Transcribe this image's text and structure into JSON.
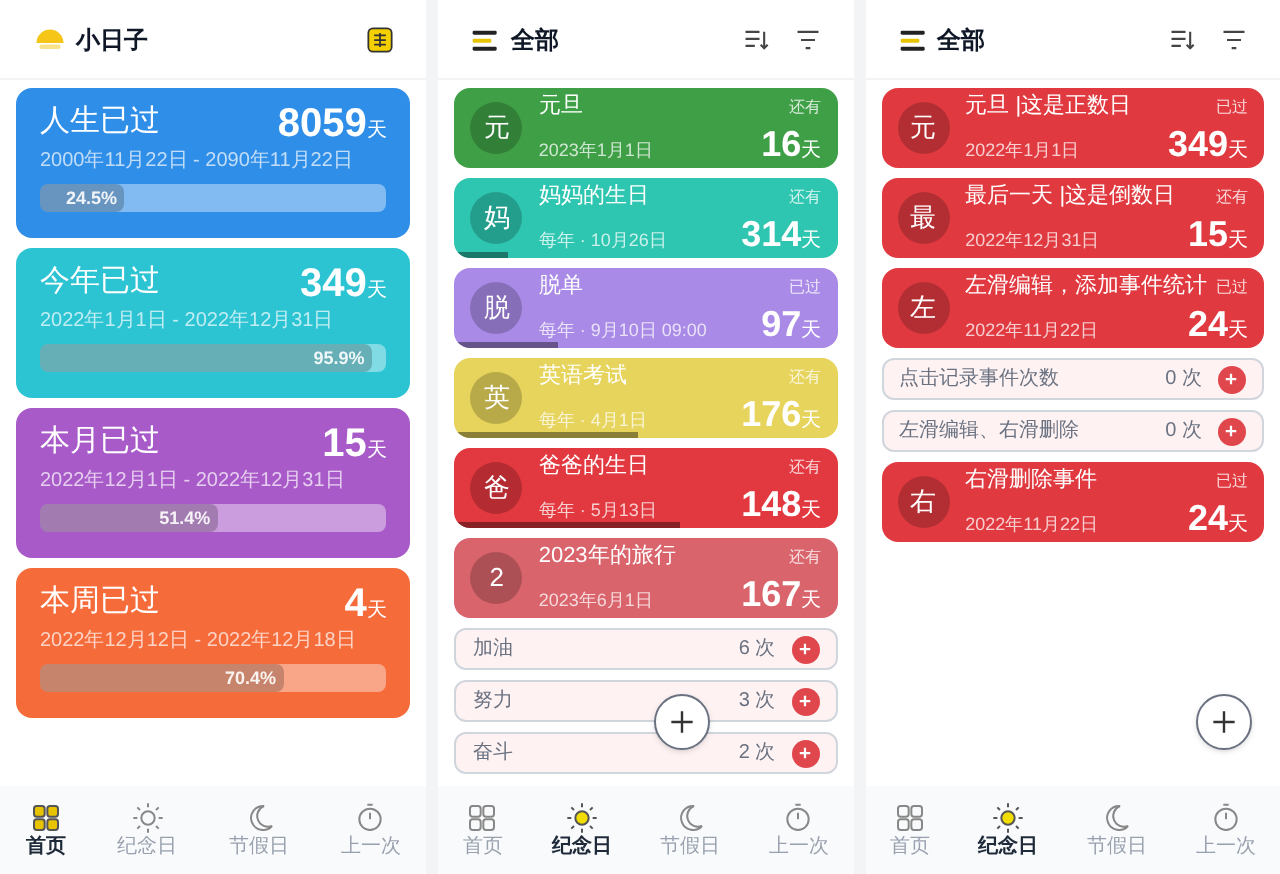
{
  "screens": [
    {
      "kind": "overview",
      "header": {
        "title": "小日子"
      },
      "cards": [
        {
          "title": "人生已过",
          "dates": "2000年11月22日 - 2090年11月22日",
          "count": "8059",
          "unit": "天",
          "percent": "24.5%",
          "level": 0.245,
          "color": "#2f8ee8"
        },
        {
          "title": "今年已过",
          "dates": "2022年1月1日 - 2022年12月31日",
          "count": "349",
          "unit": "天",
          "percent": "95.9%",
          "level": 0.959,
          "color": "#2cc3d3"
        },
        {
          "title": "本月已过",
          "dates": "2022年12月1日 - 2022年12月31日",
          "count": "15",
          "unit": "天",
          "percent": "51.4%",
          "level": 0.514,
          "color": "#a85bc8"
        },
        {
          "title": "本周已过",
          "dates": "2022年12月12日 - 2022年12月18日",
          "count": "4",
          "unit": "天",
          "percent": "70.4%",
          "level": 0.704,
          "color": "#f56b3a"
        }
      ],
      "nav": [
        {
          "label": "首页",
          "selected": true
        },
        {
          "label": "纪念日",
          "selected": false
        },
        {
          "label": "节假日",
          "selected": false
        },
        {
          "label": "上一次",
          "selected": false
        }
      ]
    },
    {
      "kind": "list",
      "header": {
        "title": "全部"
      },
      "items": [
        {
          "kind": "event",
          "avatar": "元",
          "title": "元旦",
          "subtitle": "2023年1月1日",
          "tag": "还有",
          "count": "16",
          "unit": "天",
          "color": "#3f9f47"
        },
        {
          "kind": "event",
          "avatar": "妈",
          "title": "妈妈的生日",
          "subtitle": "每年 · 10月26日",
          "tag": "还有",
          "count": "314",
          "unit": "天",
          "color": "#2ec6b0",
          "level": 0.14
        },
        {
          "kind": "event",
          "avatar": "脱",
          "title": "脱单",
          "subtitle": "每年 · 9月10日 09:00",
          "tag": "已过",
          "count": "97",
          "unit": "天",
          "color": "#a98ae6",
          "level": 0.27
        },
        {
          "kind": "event",
          "avatar": "英",
          "title": "英语考试",
          "subtitle": "每年 · 4月1日",
          "tag": "还有",
          "count": "176",
          "unit": "天",
          "color": "#e7d45c",
          "level": 0.48
        },
        {
          "kind": "event",
          "avatar": "爸",
          "title": "爸爸的生日",
          "subtitle": "每年 · 5月13日",
          "tag": "还有",
          "count": "148",
          "unit": "天",
          "color": "#e2383f",
          "level": 0.59
        },
        {
          "kind": "event",
          "avatar": "2",
          "title": "2023年的旅行",
          "subtitle": "2023年6月1日",
          "tag": "还有",
          "count": "167",
          "unit": "天",
          "color": "#d9646c"
        },
        {
          "kind": "counter",
          "title": "加油",
          "count": "6",
          "unit": "次"
        },
        {
          "kind": "counter",
          "title": "努力",
          "count": "3",
          "unit": "次"
        },
        {
          "kind": "counter",
          "title": "奋斗",
          "count": "2",
          "unit": "次"
        }
      ],
      "nav": [
        {
          "label": "首页",
          "selected": false
        },
        {
          "label": "纪念日",
          "selected": true
        },
        {
          "label": "节假日",
          "selected": false
        },
        {
          "label": "上一次",
          "selected": false
        }
      ]
    },
    {
      "kind": "list",
      "header": {
        "title": "全部"
      },
      "items": [
        {
          "kind": "event",
          "avatar": "元",
          "title": "元旦 |这是正数日",
          "subtitle": "2022年1月1日",
          "tag": "已过",
          "count": "349",
          "unit": "天",
          "color": "#e03a40"
        },
        {
          "kind": "event",
          "avatar": "最",
          "title": "最后一天 |这是倒数日",
          "subtitle": "2022年12月31日",
          "tag": "还有",
          "count": "15",
          "unit": "天",
          "color": "#e03a40"
        },
        {
          "kind": "event",
          "avatar": "左",
          "title": "左滑编辑，添加事件统计",
          "subtitle": "2022年11月22日",
          "tag": "已过",
          "count": "24",
          "unit": "天",
          "color": "#e03a40"
        },
        {
          "kind": "counter",
          "title": "点击记录事件次数",
          "count": "0",
          "unit": "次"
        },
        {
          "kind": "counter",
          "title": "左滑编辑、右滑删除",
          "count": "0",
          "unit": "次"
        },
        {
          "kind": "event",
          "avatar": "右",
          "title": "右滑删除事件",
          "subtitle": "2022年11月22日",
          "tag": "已过",
          "count": "24",
          "unit": "天",
          "color": "#e03a40"
        }
      ],
      "nav": [
        {
          "label": "首页",
          "selected": false
        },
        {
          "label": "纪念日",
          "selected": true
        },
        {
          "label": "节假日",
          "selected": false
        },
        {
          "label": "上一次",
          "selected": false
        }
      ]
    }
  ]
}
